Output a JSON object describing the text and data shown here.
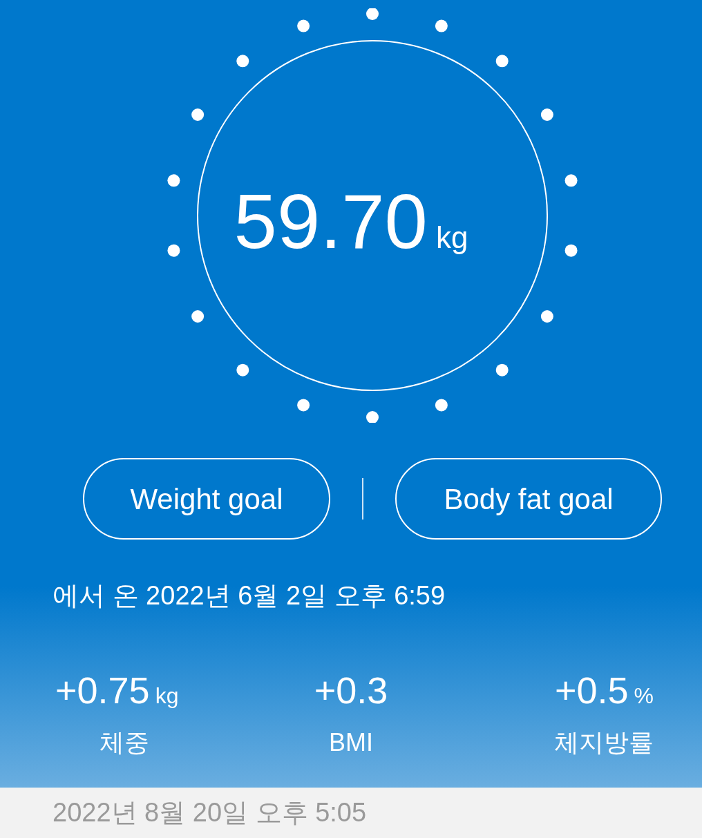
{
  "weight": {
    "value": "59.70",
    "unit": "kg"
  },
  "goal_buttons": [
    "Weight goal",
    "Body fat goal"
  ],
  "source_text": "에서 온 2022년 6월 2일 오후 6:59",
  "changes": [
    {
      "value": "+0.75",
      "unit": "kg",
      "label": "체중"
    },
    {
      "value": "+0.3",
      "label": "BMI"
    },
    {
      "value": "+0.5",
      "unit": "%",
      "label": "체지방률"
    }
  ],
  "date_header": "2022년 8월 20일 오후 5:05"
}
